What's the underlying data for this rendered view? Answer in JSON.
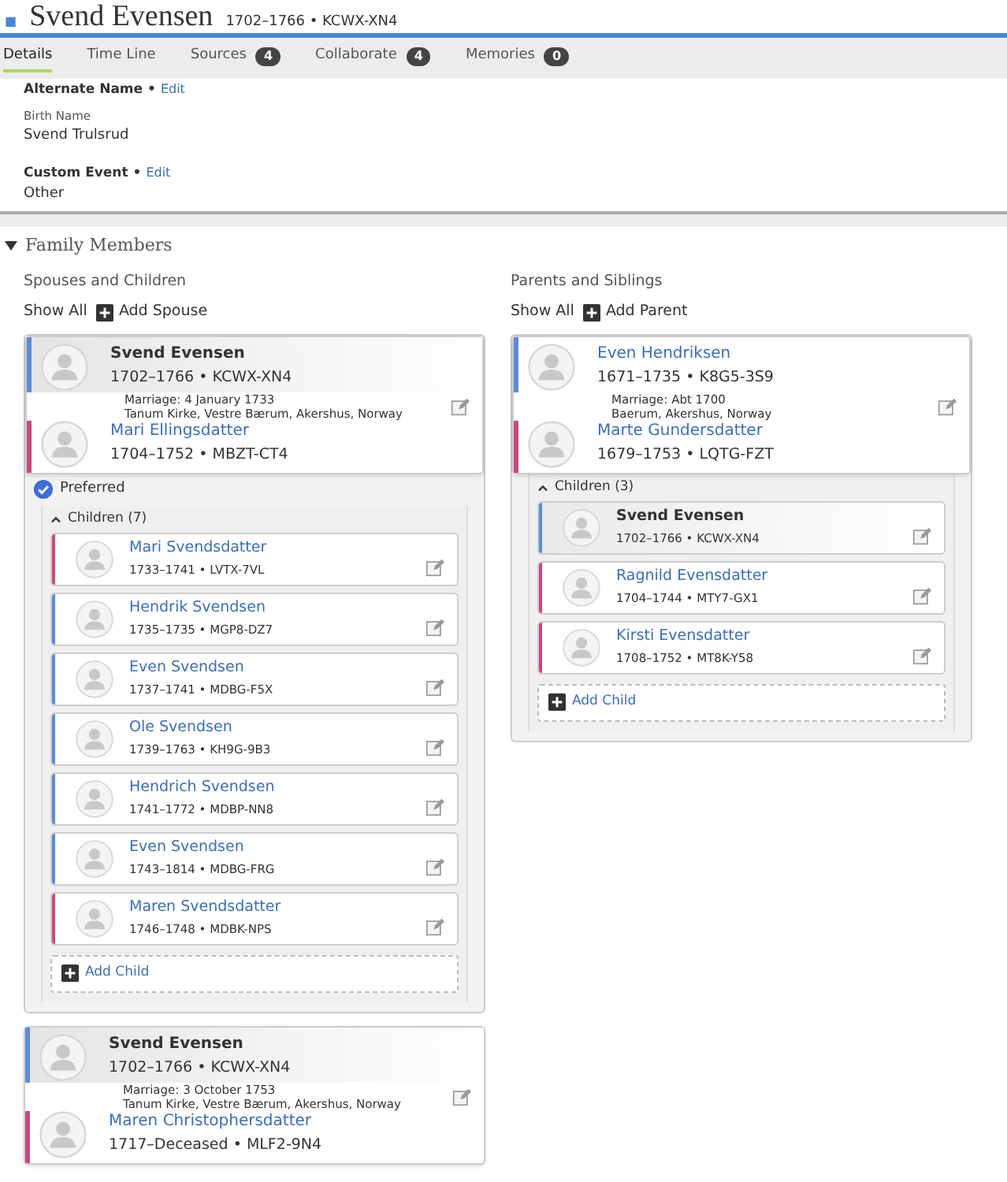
{
  "header": {
    "marker": "■",
    "name": "Svend Evensen",
    "lifespan": "1702–1766 • KCWX-XN4"
  },
  "tabs": [
    {
      "label": "Details",
      "selected": true
    },
    {
      "label": "Time Line",
      "selected": false
    },
    {
      "label": "Sources",
      "count": "4",
      "selected": false
    },
    {
      "label": "Collaborate",
      "count": "4",
      "selected": false
    },
    {
      "label": "Memories",
      "count": "0",
      "selected": false
    }
  ],
  "details": [
    {
      "title": "Alternate Name •",
      "edit": "Edit",
      "sublabel": "Birth Name",
      "value": "Svend Trulsrud"
    },
    {
      "title": "Custom Event •",
      "edit": "Edit",
      "value": "Other"
    }
  ],
  "family": {
    "title": "Family Members",
    "expanded": true,
    "spouses": {
      "title": "Spouses and Children",
      "show_all": "Show All",
      "add": "Add Spouse",
      "families": [
        {
          "husband": {
            "name": "Svend Evensen",
            "dates": "1702–1766 • KCWX-XN4",
            "color": "#5b8dd6",
            "current": true
          },
          "marriage": {
            "date": "Marriage: 4 January 1733",
            "place": "Tanum Kirke, Vestre Bærum, Akershus, Norway"
          },
          "wife": {
            "name": "Mari Ellingsdatter",
            "dates": "1704–1752 • MBZT-CT4",
            "color": "#c9497a",
            "current": false
          },
          "preferred": {
            "label": "Preferred",
            "checked": true
          },
          "children_label": "Children (7)",
          "children_expanded": true,
          "children": [
            {
              "name": "Mari Svendsdatter",
              "dates": "1733–1741 • LVTX-7VL",
              "color": "#c9497a",
              "current": false
            },
            {
              "name": "Hendrik Svendsen",
              "dates": "1735–1735 • MGP8-DZ7",
              "color": "#5b8dd6",
              "current": false
            },
            {
              "name": "Even Svendsen",
              "dates": "1737–1741 • MDBG-F5X",
              "color": "#5b8dd6",
              "current": false
            },
            {
              "name": "Ole Svendsen",
              "dates": "1739–1763 • KH9G-9B3",
              "color": "#5b8dd6",
              "current": false
            },
            {
              "name": "Hendrich Svendsen",
              "dates": "1741–1772 • MDBP-NN8",
              "color": "#5b8dd6",
              "current": false
            },
            {
              "name": "Even Svendsen",
              "dates": "1743–1814 • MDBG-FRG",
              "color": "#5b8dd6",
              "current": false
            },
            {
              "name": "Maren Svendsdatter",
              "dates": "1746–1748 • MDBK-NPS",
              "color": "#c9497a",
              "current": false
            }
          ],
          "add_child": "Add Child"
        },
        {
          "husband": {
            "name": "Svend Evensen",
            "dates": "1702–1766 • KCWX-XN4",
            "color": "#5b8dd6",
            "current": true
          },
          "marriage": {
            "date": "Marriage: 3 October 1753",
            "place": "Tanum Kirke, Vestre Bærum, Akershus, Norway"
          },
          "wife": {
            "name": "Maren Christophersdatter",
            "dates": "1717–Deceased • MLF2-9N4",
            "color": "#c9497a",
            "current": false
          }
        }
      ]
    },
    "parents": {
      "title": "Parents and Siblings",
      "show_all": "Show All",
      "add": "Add Parent",
      "families": [
        {
          "husband": {
            "name": "Even Hendriksen",
            "dates": "1671–1735 • K8G5-3S9",
            "color": "#5b8dd6",
            "current": false
          },
          "marriage": {
            "date": "Marriage: Abt 1700",
            "place": "Baerum, Akershus, Norway"
          },
          "wife": {
            "name": "Marte Gundersdatter",
            "dates": "1679–1753 • LQTG-FZT",
            "color": "#c9497a",
            "current": false
          },
          "children_label": "Children (3)",
          "children_expanded": true,
          "children": [
            {
              "name": "Svend Evensen",
              "dates": "1702–1766 • KCWX-XN4",
              "color": "#5b8dd6",
              "current": true
            },
            {
              "name": "Ragnild Evensdatter",
              "dates": "1704–1744 • MTY7-GX1",
              "color": "#c9497a",
              "current": false
            },
            {
              "name": "Kirsti Evensdatter",
              "dates": "1708–1752 • MT8K-Y58",
              "color": "#c9497a",
              "current": false
            }
          ],
          "add_child": "Add Child"
        }
      ]
    }
  }
}
